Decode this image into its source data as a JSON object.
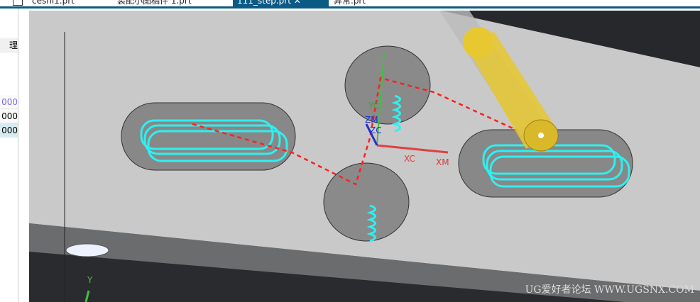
{
  "tabs": [
    {
      "label": "ceshi1.prt",
      "active": false
    },
    {
      "label": "装配小图稿件 1.prt",
      "active": false
    },
    {
      "label": "111_step.prt",
      "active": true
    },
    {
      "label": "异常.prt",
      "active": false
    }
  ],
  "panel": {
    "header": "理",
    "values": [
      "000",
      "000",
      "000"
    ]
  },
  "viewport": {
    "axis_labels": {
      "yc": "YC",
      "zm": "ZM",
      "zc": "ZC",
      "xc": "XC",
      "xm": "XM",
      "y": "Y"
    },
    "watermark": "UG爱好者论坛 WWW.UGSNX.COM",
    "colors": {
      "toolpath": "#2ef0f0",
      "rapid": "#ff2020",
      "tool": "#e8c830",
      "part": "#c8c8c8"
    }
  }
}
